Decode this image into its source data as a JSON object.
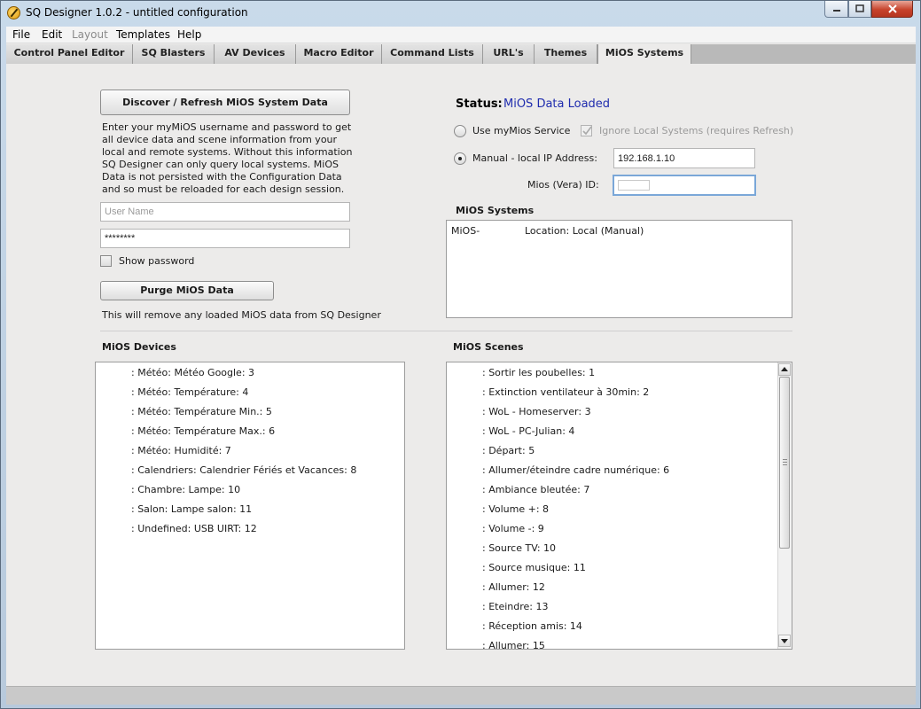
{
  "window": {
    "title": "SQ Designer 1.0.2 - untitled configuration"
  },
  "menu": [
    "File",
    "Edit",
    "Layout",
    "Templates",
    "Help"
  ],
  "tabs": [
    "Control Panel Editor",
    "SQ Blasters",
    "AV Devices",
    "Macro Editor",
    "Command Lists",
    "URL's",
    "Themes",
    "MiOS Systems"
  ],
  "left": {
    "discover_button": "Discover / Refresh MiOS System Data",
    "info_lines": [
      "Enter your myMiOS username and password to get",
      "all device data and scene information from your",
      "local and remote systems. Without this information",
      "SQ Designer can only query local systems. MiOS",
      "Data is not persisted with the Configuration  Data",
      "and so must be reloaded for each design session."
    ],
    "username_placeholder": "User Name",
    "password_value": "********",
    "show_password_label": "Show password",
    "purge_button": "Purge MiOS Data",
    "purge_note": "This will remove any loaded MiOS data from SQ Designer"
  },
  "right": {
    "status_label": "Status:",
    "status_value": "MiOS Data Loaded",
    "use_mymios_label": "Use myMios Service",
    "ignore_local_label": "Ignore Local Systems (requires Refresh)",
    "manual_ip_label": "Manual - local IP Address:",
    "ip_value": "192.168.1.10",
    "mios_id_label": "Mios (Vera) ID:",
    "mios_id_value": "",
    "systems_title": "MiOS Systems",
    "systems_row_name": "MiOS-",
    "systems_row_location": "Location: Local (Manual)"
  },
  "devices": {
    "title": "MiOS Devices",
    "items": [
      ": Météo: Météo Google: 3",
      ": Météo: Température: 4",
      ": Météo: Température Min.: 5",
      ": Météo: Température Max.: 6",
      ": Météo: Humidité: 7",
      ": Calendriers: Calendrier Fériés et Vacances: 8",
      ": Chambre: Lampe: 10",
      ": Salon: Lampe salon: 11",
      ": Undefined: USB UIRT: 12"
    ]
  },
  "scenes": {
    "title": "MiOS Scenes",
    "items": [
      ": Sortir les poubelles: 1",
      ": Extinction ventilateur à 30min: 2",
      ": WoL - Homeserver: 3",
      ": WoL - PC-Julian: 4",
      ": Départ: 5",
      ": Allumer/éteindre cadre numérique: 6",
      ": Ambiance bleutée: 7",
      ": Volume +: 8",
      ": Volume -: 9",
      ": Source TV: 10",
      ": Source musique: 11",
      ": Allumer: 12",
      ": Eteindre: 13",
      ": Réception amis: 14",
      ": Allumer: 15"
    ]
  },
  "colors": {
    "status_value": "#1f2cae",
    "close_button": "#c7432c"
  }
}
